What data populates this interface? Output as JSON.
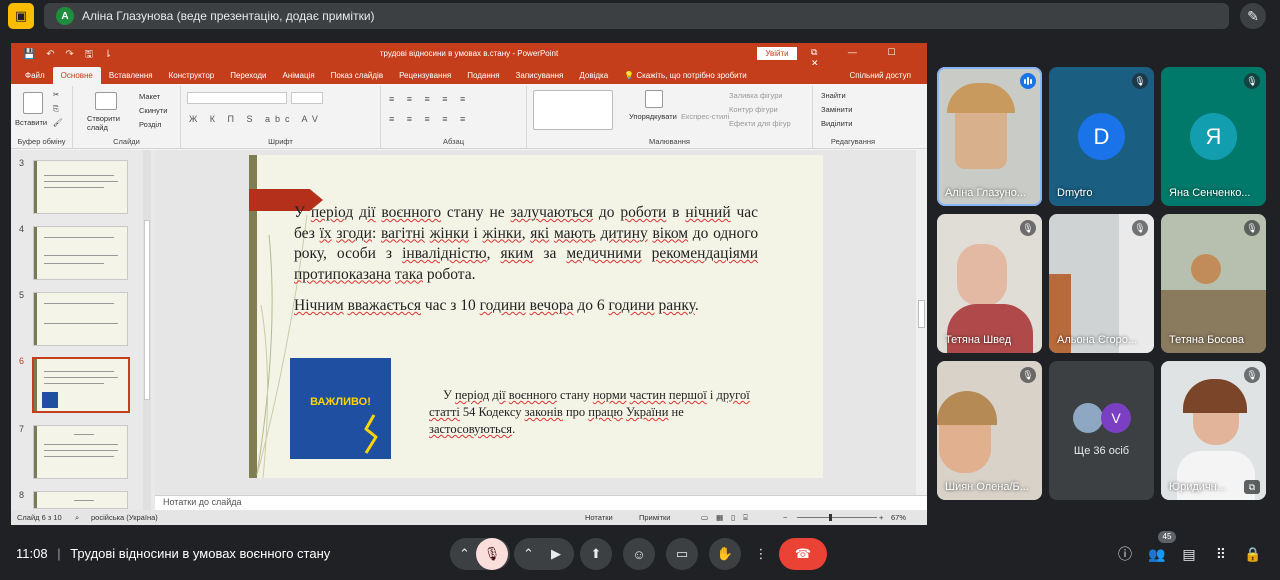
{
  "meet": {
    "presenter_label": "Аліна Глазунова (веде презентацію, додає примітки)",
    "presenter_initial": "A",
    "time": "11:08",
    "separator": "|",
    "meeting_title": "Трудові відносини в умовах воєнного стану",
    "participants_count": "45",
    "accent_color": "#8ab4f8",
    "end_call_color": "#ea4335",
    "mic_off_color": "#f9dedc"
  },
  "powerpoint": {
    "quick_access": "💾 ↶ ↷ 🖫 ⇂",
    "doc_title": "трудові відносини в умовах в.стану  -  PowerPoint",
    "sign_in": "Увійти",
    "window_controls": "⧉ — ☐ ✕",
    "tabs": [
      "Файл",
      "Основне",
      "Вставлення",
      "Конструктор",
      "Переходи",
      "Анімація",
      "Показ слайдів",
      "Рецензування",
      "Подання",
      "Записування",
      "Довідка",
      "💡 Скажіть, що потрібно зробити",
      "Спільний доступ"
    ],
    "ribbon": {
      "paste": "Вставити",
      "cut": "Вирізати",
      "clipboard_group": "Буфер обміну",
      "new_slide": "Створити слайд",
      "layout": "Макет",
      "reset": "Скинути",
      "section": "Розділ",
      "slides_group": "Слайди",
      "font_glyphs": "Ж К П S abc AV",
      "font_group": "Шрифт",
      "paragraph_glyphs": "≡ ≡ ≡ ≡ ≡",
      "paragraph_group": "Абзац",
      "arrange": "Упорядкувати",
      "express_styles": "Експрес-стилі",
      "shape_fill": "Заливка фігури",
      "shape_outline": "Контур фігури",
      "shape_effects": "Ефекти для фігур",
      "drawing_group": "Малювання",
      "find": "Знайти",
      "replace": "Замінити",
      "select": "Виділити",
      "editing_group": "Редагування"
    },
    "slide_numbers": [
      "3",
      "4",
      "5",
      "6",
      "7",
      "8"
    ],
    "slide": {
      "p1_segments": [
        {
          "t": "У ",
          "u": false
        },
        {
          "t": "період",
          "u": true
        },
        {
          "t": " ",
          "u": false
        },
        {
          "t": "дії",
          "u": true
        },
        {
          "t": " ",
          "u": false
        },
        {
          "t": "воєнного",
          "u": true
        },
        {
          "t": " стану не ",
          "u": false
        },
        {
          "t": "залучаються",
          "u": true
        },
        {
          "t": " до ",
          "u": false
        },
        {
          "t": "роботи",
          "u": true
        },
        {
          "t": " в ",
          "u": false
        },
        {
          "t": "нічний",
          "u": true
        },
        {
          "t": " час без ",
          "u": false
        },
        {
          "t": "їх",
          "u": true
        },
        {
          "t": " ",
          "u": false
        },
        {
          "t": "згоди",
          "u": true
        },
        {
          "t": ": ",
          "u": false
        },
        {
          "t": "вагітні",
          "u": true
        },
        {
          "t": " ",
          "u": false
        },
        {
          "t": "жінки",
          "u": true
        },
        {
          "t": " і ",
          "u": false
        },
        {
          "t": "жінки",
          "u": true
        },
        {
          "t": ", ",
          "u": false
        },
        {
          "t": "які",
          "u": true
        },
        {
          "t": " ",
          "u": false
        },
        {
          "t": "мають",
          "u": true
        },
        {
          "t": " ",
          "u": false
        },
        {
          "t": "дитину",
          "u": true
        },
        {
          "t": " ",
          "u": false
        },
        {
          "t": "віком",
          "u": true
        },
        {
          "t": " до одного року, особи з ",
          "u": false
        },
        {
          "t": "інвалідністю",
          "u": true
        },
        {
          "t": ", ",
          "u": false
        },
        {
          "t": "яким",
          "u": true
        },
        {
          "t": " за ",
          "u": false
        },
        {
          "t": "медичними",
          "u": true
        },
        {
          "t": " ",
          "u": false
        },
        {
          "t": "рекомендаціями",
          "u": true
        },
        {
          "t": " ",
          "u": false
        },
        {
          "t": "протипоказана",
          "u": true
        },
        {
          "t": " ",
          "u": false
        },
        {
          "t": "така",
          "u": true
        },
        {
          "t": " робота.",
          "u": false
        }
      ],
      "p2_segments": [
        {
          "t": "Нічним",
          "u": true
        },
        {
          "t": " ",
          "u": false
        },
        {
          "t": "вважається",
          "u": true
        },
        {
          "t": " час з 10 ",
          "u": false
        },
        {
          "t": "години",
          "u": true
        },
        {
          "t": " ",
          "u": false
        },
        {
          "t": "вечора",
          "u": true
        },
        {
          "t": " до 6 ",
          "u": false
        },
        {
          "t": "години",
          "u": true
        },
        {
          "t": " ",
          "u": false
        },
        {
          "t": "ранку",
          "u": true
        },
        {
          "t": ".",
          "u": false
        }
      ],
      "p3_segments": [
        {
          "t": "У ",
          "u": false
        },
        {
          "t": "період",
          "u": true
        },
        {
          "t": " ",
          "u": false
        },
        {
          "t": "дії",
          "u": true
        },
        {
          "t": " ",
          "u": false
        },
        {
          "t": "воєнного",
          "u": true
        },
        {
          "t": " стану ",
          "u": false
        },
        {
          "t": "норми",
          "u": true
        },
        {
          "t": " ",
          "u": false
        },
        {
          "t": "частин",
          "u": true
        },
        {
          "t": " ",
          "u": false
        },
        {
          "t": "першої",
          "u": true
        },
        {
          "t": " і ",
          "u": false
        },
        {
          "t": "другої",
          "u": true
        },
        {
          "t": " ",
          "u": false
        },
        {
          "t": "статті",
          "u": true
        },
        {
          "t": " 54 Кодексу ",
          "u": false
        },
        {
          "t": "законів",
          "u": true
        },
        {
          "t": " про ",
          "u": false
        },
        {
          "t": "працю",
          "u": true
        },
        {
          "t": " ",
          "u": false
        },
        {
          "t": "України",
          "u": true
        },
        {
          "t": " не ",
          "u": false
        },
        {
          "t": "застосовуються",
          "u": true
        },
        {
          "t": ".",
          "u": false
        }
      ],
      "important_label": "ВАЖЛИВО!",
      "brand_red": "#b5301a",
      "brand_blue": "#1e4fa0",
      "brand_yellow": "#ffd400"
    },
    "notes_placeholder": "Нотатки до слайда",
    "status": {
      "slide_counter": "Слайд 6 з 10",
      "language": "російська (Україна)",
      "notes": "Нотатки",
      "comments": "Примітки",
      "zoom": "67%"
    }
  },
  "participants": [
    {
      "name": "Аліна Глазуно...",
      "type": "video",
      "speaking": true
    },
    {
      "name": "Dmytro",
      "type": "avatar",
      "initial": "D",
      "avatar_color": "#1a73e8",
      "bg": "blue"
    },
    {
      "name": "Яна Сенченко...",
      "type": "avatar",
      "initial": "Я",
      "avatar_color": "#129eaf",
      "bg": "teal"
    },
    {
      "name": "Тетяна Швед",
      "type": "video"
    },
    {
      "name": "Альона Єгоро...",
      "type": "video"
    },
    {
      "name": "Тетяна Босова",
      "type": "video"
    },
    {
      "name": "Шиян Олена/Б...",
      "type": "video"
    },
    {
      "name": "Ще 36 осіб",
      "type": "more",
      "more_initial": "V"
    },
    {
      "name": "Юридичн...",
      "type": "video"
    }
  ]
}
